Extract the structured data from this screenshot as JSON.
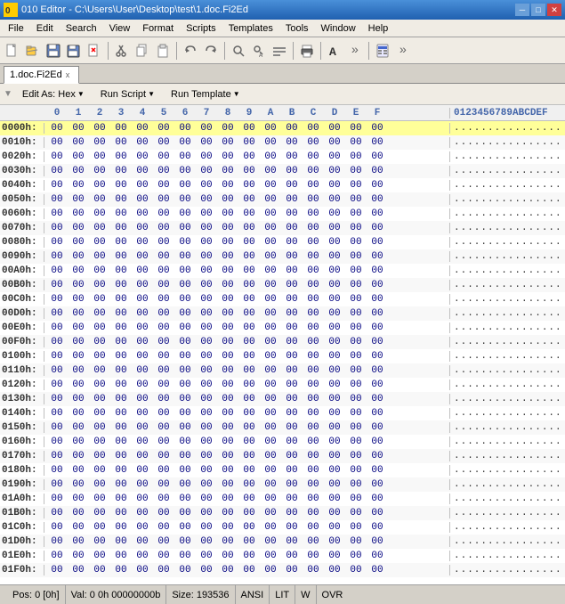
{
  "titlebar": {
    "text": "010 Editor - C:\\Users\\User\\Desktop\\test\\1.doc.Fi2Ed",
    "minimize": "─",
    "maximize": "□",
    "close": "✕"
  },
  "menu": {
    "items": [
      "File",
      "Edit",
      "Search",
      "View",
      "Format",
      "Scripts",
      "Templates",
      "Tools",
      "Window",
      "Help"
    ]
  },
  "tab": {
    "label": "1.doc.Fi2Ed",
    "close": "x"
  },
  "subtoolbar": {
    "edit_as": "Edit As: Hex",
    "run_script": "Run Script",
    "run_template": "Run Template"
  },
  "header": {
    "cols": [
      "0",
      "1",
      "2",
      "3",
      "4",
      "5",
      "6",
      "7",
      "8",
      "9",
      "A",
      "B",
      "C",
      "D",
      "E",
      "F"
    ],
    "ascii_header": "0123456789ABCDEF"
  },
  "rows": [
    {
      "addr": "0000h:",
      "selected": true
    },
    {
      "addr": "0010h:",
      "selected": false
    },
    {
      "addr": "0020h:",
      "selected": false
    },
    {
      "addr": "0030h:",
      "selected": false
    },
    {
      "addr": "0040h:",
      "selected": false
    },
    {
      "addr": "0050h:",
      "selected": false
    },
    {
      "addr": "0060h:",
      "selected": false
    },
    {
      "addr": "0070h:",
      "selected": false
    },
    {
      "addr": "0080h:",
      "selected": false
    },
    {
      "addr": "0090h:",
      "selected": false
    },
    {
      "addr": "00A0h:",
      "selected": false
    },
    {
      "addr": "00B0h:",
      "selected": false
    },
    {
      "addr": "00C0h:",
      "selected": false
    },
    {
      "addr": "00D0h:",
      "selected": false
    },
    {
      "addr": "00E0h:",
      "selected": false
    },
    {
      "addr": "00F0h:",
      "selected": false
    },
    {
      "addr": "0100h:",
      "selected": false
    },
    {
      "addr": "0110h:",
      "selected": false
    },
    {
      "addr": "0120h:",
      "selected": false
    },
    {
      "addr": "0130h:",
      "selected": false
    },
    {
      "addr": "0140h:",
      "selected": false
    },
    {
      "addr": "0150h:",
      "selected": false
    },
    {
      "addr": "0160h:",
      "selected": false
    },
    {
      "addr": "0170h:",
      "selected": false
    },
    {
      "addr": "0180h:",
      "selected": false
    },
    {
      "addr": "0190h:",
      "selected": false
    },
    {
      "addr": "01A0h:",
      "selected": false
    },
    {
      "addr": "01B0h:",
      "selected": false
    },
    {
      "addr": "01C0h:",
      "selected": false
    },
    {
      "addr": "01D0h:",
      "selected": false
    },
    {
      "addr": "01E0h:",
      "selected": false
    },
    {
      "addr": "01F0h:",
      "selected": false
    }
  ],
  "status": {
    "pos": "Pos: 0 [0h]",
    "val": "Val: 0 0h 00000000b",
    "size": "Size: 193536",
    "encoding": "ANSI",
    "lit": "LIT",
    "mode1": "W",
    "mode2": "OVR"
  }
}
